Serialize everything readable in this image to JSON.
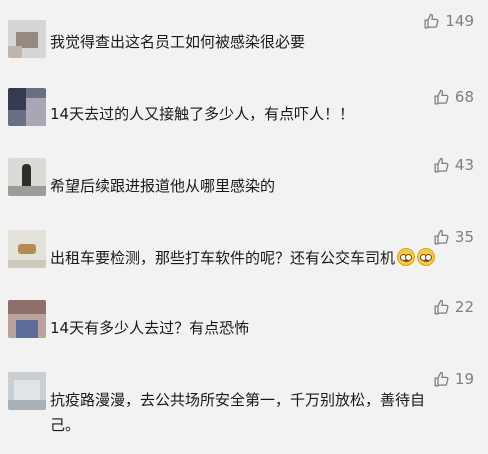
{
  "comments": [
    {
      "nickname": "",
      "text": "我觉得查出这名员工如何被感染很必要",
      "likes": "149",
      "avatar_colors": [
        "#cfcfcf",
        "#9a8f86",
        "#e8e8e8"
      ]
    },
    {
      "nickname": "",
      "text": "14天去过的人又接触了多少人，有点吓人！！",
      "likes": "68",
      "avatar_colors": [
        "#3a3f56",
        "#a9a5b8",
        "#6a6e80"
      ]
    },
    {
      "nickname": "",
      "text": "希望后续跟进报道他从哪里感染的",
      "likes": "43",
      "avatar_colors": [
        "#d9dcd8",
        "#2d2f2c",
        "#8c9088"
      ]
    },
    {
      "nickname": "",
      "text": "出租车要检测，那些打车软件的呢？还有公交车司机",
      "likes": "35",
      "avatar_colors": [
        "#e6e3dd",
        "#b58a55",
        "#d7d2c8"
      ]
    },
    {
      "nickname": "",
      "text": "14天有多少人去过？有点恐怖",
      "likes": "22",
      "avatar_colors": [
        "#9a7b78",
        "#5e6c9a",
        "#c7b2a8"
      ]
    },
    {
      "nickname": "",
      "text": "抗疫路漫漫，去公共场所安全第一，千万别放松，善待自己。",
      "likes": "19",
      "avatar_colors": [
        "#c7ccd0",
        "#dfe2e4",
        "#a7b0b7"
      ]
    }
  ],
  "icons": {
    "like": "thumbs-up-outline-icon",
    "emoji": "pleading-face-emoji-icon"
  },
  "colors": {
    "background": "#f2f2f2",
    "text": "#191919",
    "meta": "#7f7f7f"
  }
}
